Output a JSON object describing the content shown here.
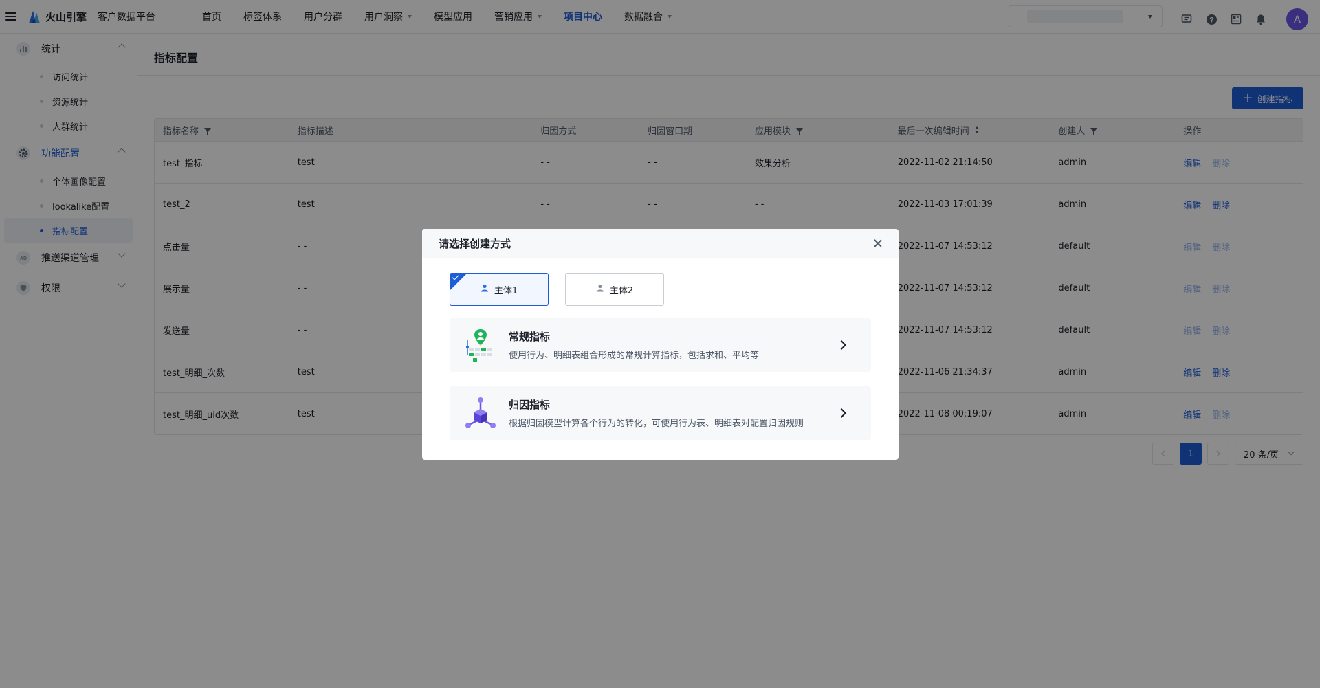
{
  "topbar": {
    "brand": "火山引擎",
    "product": "客户数据平台",
    "nav": [
      {
        "label": "首页",
        "dropdown": false,
        "active": false
      },
      {
        "label": "标签体系",
        "dropdown": false,
        "active": false
      },
      {
        "label": "用户分群",
        "dropdown": false,
        "active": false
      },
      {
        "label": "用户洞察",
        "dropdown": true,
        "active": false
      },
      {
        "label": "模型应用",
        "dropdown": false,
        "active": false
      },
      {
        "label": "营销应用",
        "dropdown": true,
        "active": false
      },
      {
        "label": "项目中心",
        "dropdown": false,
        "active": true
      },
      {
        "label": "数据融合",
        "dropdown": true,
        "active": false
      }
    ],
    "avatar_letter": "A",
    "accent": "#1e5dd8"
  },
  "sidebar": {
    "groups": [
      {
        "label": "统计",
        "icon": "bar-chart-icon",
        "expanded": true,
        "items": [
          "访问统计",
          "资源统计",
          "人群统计"
        ]
      },
      {
        "label": "功能配置",
        "icon": "gear-icon",
        "expanded": true,
        "active": true,
        "items": [
          "个体画像配置",
          "lookalike配置",
          "指标配置"
        ]
      },
      {
        "label": "推送渠道管理",
        "icon": "ad-icon",
        "expanded": false,
        "items": []
      },
      {
        "label": "权限",
        "icon": "shield-icon",
        "expanded": false,
        "items": []
      }
    ],
    "active_item": "指标配置"
  },
  "main": {
    "title": "指标配置",
    "create_button": "创建指标",
    "columns": [
      "指标名称",
      "指标描述",
      "归因方式",
      "归因窗口期",
      "应用模块",
      "最后一次编辑时间",
      "创建人",
      "操作"
    ],
    "rows": [
      {
        "name": "test_指标",
        "desc": "test",
        "attr_method": "- -",
        "attr_window": "- -",
        "module": "效果分析",
        "edited": "2022-11-02 21:14:50",
        "creator": "admin",
        "edit": "编辑",
        "delete": "删除",
        "edit_enabled": true,
        "delete_enabled": false
      },
      {
        "name": "test_2",
        "desc": "test",
        "attr_method": "- -",
        "attr_window": "- -",
        "module": "- -",
        "edited": "2022-11-03 17:01:39",
        "creator": "admin",
        "edit": "编辑",
        "delete": "删除",
        "edit_enabled": true,
        "delete_enabled": true
      },
      {
        "name": "点击量",
        "desc": "- -",
        "attr_method": "",
        "attr_window": "",
        "module": "",
        "edited": "2022-11-07 14:53:12",
        "creator": "default",
        "edit": "编辑",
        "delete": "删除",
        "edit_enabled": false,
        "delete_enabled": false
      },
      {
        "name": "展示量",
        "desc": "- -",
        "attr_method": "",
        "attr_window": "",
        "module": "",
        "edited": "2022-11-07 14:53:12",
        "creator": "default",
        "edit": "编辑",
        "delete": "删除",
        "edit_enabled": false,
        "delete_enabled": false
      },
      {
        "name": "发送量",
        "desc": "- -",
        "attr_method": "",
        "attr_window": "",
        "module": "",
        "edited": "2022-11-07 14:53:12",
        "creator": "default",
        "edit": "编辑",
        "delete": "删除",
        "edit_enabled": false,
        "delete_enabled": false
      },
      {
        "name": "test_明细_次数",
        "desc": "test",
        "attr_method": "",
        "attr_window": "",
        "module": "",
        "edited": "2022-11-06 21:34:37",
        "creator": "admin",
        "edit": "编辑",
        "delete": "删除",
        "edit_enabled": true,
        "delete_enabled": true
      },
      {
        "name": "test_明细_uid次数",
        "desc": "test",
        "attr_method": "",
        "attr_window": "",
        "module": "",
        "edited": "2022-11-08 00:19:07",
        "creator": "admin",
        "edit": "编辑",
        "delete": "删除",
        "edit_enabled": true,
        "delete_enabled": false
      }
    ],
    "pagination": {
      "current_page": "1",
      "page_size": "20 条/页"
    }
  },
  "modal": {
    "title": "请选择创建方式",
    "subjects": [
      {
        "label": "主体1",
        "selected": true
      },
      {
        "label": "主体2",
        "selected": false
      }
    ],
    "options": [
      {
        "title": "常规指标",
        "desc": "使用行为、明细表组合形成的常规计算指标，包括求和、平均等",
        "icon": "regular-metric-icon"
      },
      {
        "title": "归因指标",
        "desc": "根据归因模型计算各个行为的转化，可使用行为表、明细表对配置归因规则",
        "icon": "attribution-metric-icon"
      }
    ]
  }
}
